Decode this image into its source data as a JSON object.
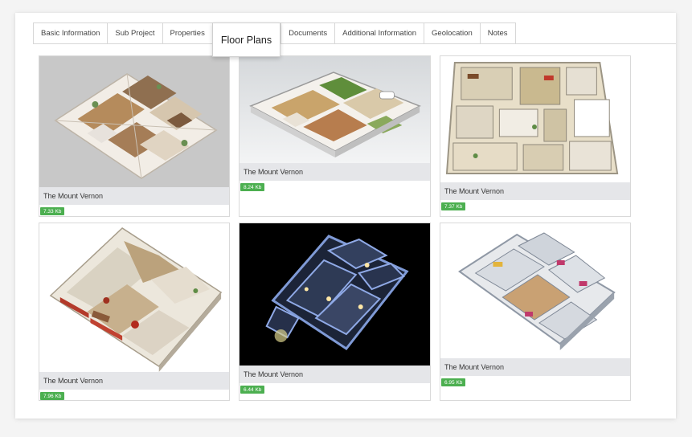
{
  "tabs": [
    {
      "label": "Basic Information"
    },
    {
      "label": "Sub Project"
    },
    {
      "label": "Properties"
    },
    {
      "label": "Floor Plans"
    },
    {
      "label": "Documents"
    },
    {
      "label": "Additional Information"
    },
    {
      "label": "Geolocation"
    },
    {
      "label": "Notes"
    }
  ],
  "active_tab": "Floor Plans",
  "floor_plans": [
    {
      "title": "The Mount Vernon",
      "size": "7.33 Kb"
    },
    {
      "title": "The Mount Vernon",
      "size": "8.24 Kb"
    },
    {
      "title": "The Mount Vernon",
      "size": "7.37 Kb"
    },
    {
      "title": "The Mount Vernon",
      "size": "7.96 Kb"
    },
    {
      "title": "The Mount Vernon",
      "size": "6.44 Kb"
    },
    {
      "title": "The Mount Vernon",
      "size": "6.95 Kb"
    }
  ],
  "colors": {
    "badge": "#4caf50",
    "caption_bg": "#e5e6e9",
    "dark_thumb_bg": "#000000"
  }
}
